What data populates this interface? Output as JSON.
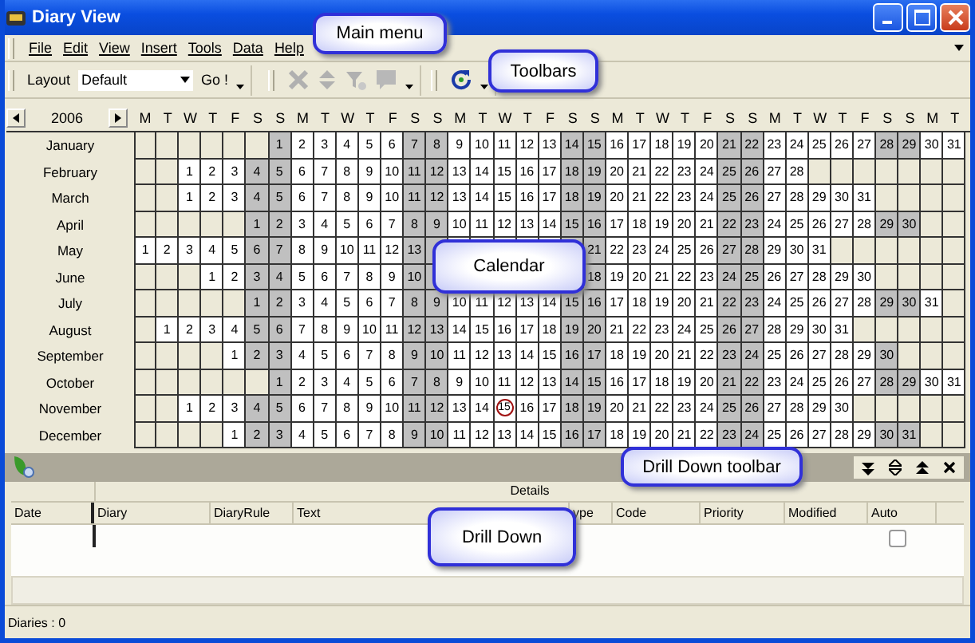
{
  "window": {
    "title": "Diary View"
  },
  "menu": [
    "File",
    "Edit",
    "View",
    "Insert",
    "Tools",
    "Data",
    "Help"
  ],
  "toolbar": {
    "layout_label": "Layout",
    "layout_value": "Default",
    "go_button": "Go !"
  },
  "calendar": {
    "year": "2006",
    "weekdays": [
      "M",
      "T",
      "W",
      "T",
      "F",
      "S",
      "S",
      "M",
      "T",
      "W",
      "T",
      "F",
      "S",
      "S",
      "M",
      "T",
      "W",
      "T",
      "F",
      "S",
      "S",
      "M",
      "T",
      "W",
      "T",
      "F",
      "S",
      "S",
      "M",
      "T",
      "W",
      "T",
      "F",
      "S",
      "S",
      "M",
      "T"
    ],
    "months": [
      {
        "name": "January",
        "days": [
          "1",
          "2",
          "3",
          "4",
          "5",
          "6",
          "7",
          "8",
          "9",
          "10",
          "11",
          "12",
          "13",
          "14",
          "15",
          "16",
          "17",
          "18",
          "19",
          "20",
          "21",
          "22",
          "23",
          "24",
          "25",
          "26",
          "27",
          "28",
          "29",
          "30",
          "31"
        ]
      },
      {
        "name": "February",
        "days": [
          "1",
          "2",
          "3",
          "4",
          "5",
          "6",
          "7",
          "8",
          "9",
          "10",
          "11",
          "12",
          "13",
          "14",
          "15",
          "16",
          "17",
          "18",
          "19",
          "20",
          "21",
          "22",
          "23",
          "24",
          "25",
          "26",
          "27",
          "28"
        ]
      },
      {
        "name": "March",
        "days": [
          "1",
          "2",
          "3",
          "4",
          "5",
          "6",
          "7",
          "8",
          "9",
          "10",
          "11",
          "12",
          "13",
          "14",
          "15",
          "16",
          "17",
          "18",
          "19",
          "20",
          "21",
          "22",
          "23",
          "24",
          "25",
          "26",
          "27",
          "28",
          "29",
          "30",
          "31"
        ]
      },
      {
        "name": "April",
        "days": [
          "1",
          "2",
          "3",
          "4",
          "5",
          "6",
          "7",
          "8",
          "9",
          "10",
          "11",
          "12",
          "13",
          "14",
          "15",
          "16",
          "17",
          "18",
          "19",
          "20",
          "21",
          "22",
          "23",
          "24",
          "25",
          "26",
          "27",
          "28",
          "29",
          "30"
        ]
      },
      {
        "name": "May",
        "days": [
          "1",
          "2",
          "3",
          "4",
          "5",
          "6",
          "7",
          "8",
          "9",
          "10",
          "11",
          "12",
          "13",
          "21",
          "22",
          "23",
          "24",
          "25",
          "26",
          "27",
          "28",
          "29",
          "30",
          "31"
        ]
      },
      {
        "name": "June",
        "days": [
          "1",
          "2",
          "3",
          "4",
          "5",
          "6",
          "7",
          "8",
          "9",
          "10",
          "18",
          "19",
          "20",
          "21",
          "22",
          "23",
          "24",
          "25",
          "26",
          "27",
          "28",
          "29",
          "30"
        ]
      },
      {
        "name": "July",
        "days": [
          "1",
          "2",
          "3",
          "4",
          "5",
          "6",
          "7",
          "8",
          "9",
          "10",
          "11",
          "12",
          "13",
          "14",
          "15",
          "16",
          "17",
          "18",
          "19",
          "20",
          "21",
          "22",
          "23",
          "24",
          "25",
          "26",
          "27",
          "28",
          "29",
          "30",
          "31"
        ]
      },
      {
        "name": "August",
        "days": [
          "1",
          "2",
          "3",
          "4",
          "5",
          "6",
          "7",
          "8",
          "9",
          "10",
          "11",
          "12",
          "13",
          "14",
          "15",
          "16",
          "17",
          "18",
          "19",
          "20",
          "21",
          "22",
          "23",
          "24",
          "25",
          "26",
          "27",
          "28",
          "29",
          "30",
          "31"
        ]
      },
      {
        "name": "September",
        "days": [
          "1",
          "2",
          "3",
          "4",
          "5",
          "6",
          "7",
          "8",
          "9",
          "10",
          "11",
          "12",
          "13",
          "14",
          "15",
          "16",
          "17",
          "18",
          "19",
          "20",
          "21",
          "22",
          "23",
          "24",
          "25",
          "26",
          "27",
          "28",
          "29",
          "30"
        ]
      },
      {
        "name": "October",
        "days": [
          "1",
          "2",
          "3",
          "4",
          "5",
          "6",
          "7",
          "8",
          "9",
          "10",
          "11",
          "12",
          "13",
          "14",
          "15",
          "16",
          "17",
          "18",
          "19",
          "20",
          "21",
          "22",
          "23",
          "24",
          "25",
          "26",
          "27",
          "28",
          "29",
          "30",
          "31"
        ]
      },
      {
        "name": "November",
        "days": [
          "1",
          "2",
          "3",
          "4",
          "5",
          "6",
          "7",
          "8",
          "9",
          "10",
          "11",
          "12",
          "13",
          "14",
          {
            "text": "15",
            "circled": true
          },
          "16",
          "17",
          "18",
          "19",
          "20",
          "21",
          "22",
          "23",
          "24",
          "25",
          "26",
          "27",
          "28",
          "29",
          "30"
        ]
      },
      {
        "name": "December",
        "days": [
          "1",
          "2",
          "3",
          "4",
          "5",
          "6",
          "7",
          "8",
          "9",
          "10",
          "11",
          "12",
          "13",
          "14",
          "15",
          "16",
          "17",
          "18",
          "19",
          "20",
          "21",
          "22",
          "23",
          "24",
          "25",
          "26",
          "27",
          "28",
          "29",
          "30",
          "31"
        ]
      }
    ]
  },
  "drill_down": {
    "details_header": "Details",
    "columns": [
      "Date",
      "Diary",
      "DiaryRule",
      "Text",
      "ype",
      "Code",
      "Priority",
      "Modified",
      "Auto"
    ],
    "auto_checked": false
  },
  "status_bar": "Diaries : 0",
  "callouts": [
    "Main menu",
    "Toolbars",
    "Calendar",
    "Drill Down toolbar",
    "Drill Down"
  ]
}
